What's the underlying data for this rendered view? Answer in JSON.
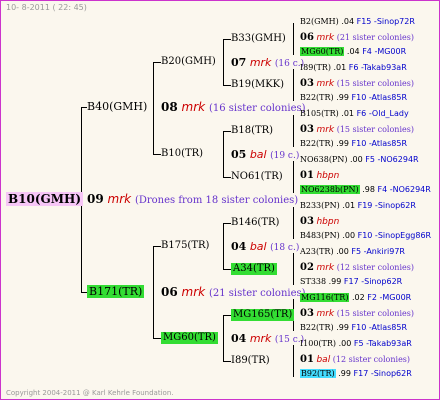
{
  "header": {
    "date": "10- 8-2011 ( 22: 45)"
  },
  "footer": {
    "copyright": "Copyright 2004-2011 @ Karl Kehrle Foundation."
  },
  "root": {
    "name": "B10(GMH)",
    "gen": "09",
    "mark": "mrk",
    "note": "(Drones from 18 sister colonies)"
  },
  "gen2": [
    {
      "name": "B40(GMH)",
      "gen": "08",
      "mark": "mrk",
      "note": "(16 sister colonies)"
    },
    {
      "name": "B171(TR)",
      "gen": "06",
      "mark": "mrk",
      "note": "(21 sister colonies)"
    }
  ],
  "gen3": [
    {
      "name": "B20(GMH)",
      "gen": "07",
      "mark": "mrk",
      "note": "(16 c.)"
    },
    {
      "name": "B10(TR)",
      "gen": "05",
      "mark": "bal",
      "note": "(19 c.)"
    },
    {
      "name": "B175(TR)",
      "gen": "04",
      "mark": "bal",
      "note": "(18 c.)"
    },
    {
      "name": "MG60(TR)",
      "gen": "04",
      "mark": "mrk",
      "note": "(15 c.)"
    }
  ],
  "gen4": [
    {
      "name": "B33(GMH)"
    },
    {
      "name": "B19(MKK)"
    },
    {
      "name": "B18(TR)"
    },
    {
      "name": "NO61(TR)"
    },
    {
      "name": "B146(TR)"
    },
    {
      "name": "A34(TR)"
    },
    {
      "name": "MG165(TR)"
    },
    {
      "name": "I89(TR)"
    }
  ],
  "gen5": [
    {
      "name": "B2(GMH)",
      "pct": ".04",
      "code": "F15 -Sinop72R"
    },
    {
      "gen": "06",
      "mark": "mrk",
      "note": "(21 sister colonies)"
    },
    {
      "name": "MG60(TR)",
      "pct": ".04",
      "code": "F4 -MG00R"
    },
    {
      "name": "I89(TR)",
      "pct": ".01",
      "code": "F6 -Takab93aR"
    },
    {
      "gen": "03",
      "mark": "mrk",
      "note": "(15 sister colonies)"
    },
    {
      "name": "B22(TR)",
      "pct": ".99",
      "code": "F10 -Atlas85R"
    },
    {
      "name": "B105(TR)",
      "pct": ".01",
      "code": "F6 -Old_Lady"
    },
    {
      "gen": "03",
      "mark": "mrk",
      "note": "(15 sister colonies)"
    },
    {
      "name": "B22(TR)",
      "pct": ".99",
      "code": "F10 -Atlas85R"
    },
    {
      "name": "NO638(PN)",
      "pct": ".00",
      "code": "F5 -NO6294R"
    },
    {
      "gen": "01",
      "mark": "hbpn",
      "note": ""
    },
    {
      "name": "NO6238b(PN)",
      "pct": ".98",
      "code": "F4 -NO6294R"
    },
    {
      "name": "B233(PN)",
      "pct": ".01",
      "code": "F19 -Sinop62R"
    },
    {
      "gen": "03",
      "mark": "hbpn",
      "note": ""
    },
    {
      "name": "B483(PN)",
      "pct": ".00",
      "code": "F10 -SinopEgg86R"
    },
    {
      "name": "A23(TR)",
      "pct": ".00",
      "code": "F5 -Ankiri97R"
    },
    {
      "gen": "02",
      "mark": "mrk",
      "note": "(12 sister colonies)"
    },
    {
      "name": "ST338",
      "pct": ".99",
      "code": "F17 -Sinop62R"
    },
    {
      "name": "MG116(TR)",
      "pct": ".02",
      "code": "F2 -MG00R"
    },
    {
      "gen": "03",
      "mark": "mrk",
      "note": "(15 sister colonies)"
    },
    {
      "name": "B22(TR)",
      "pct": ".99",
      "code": "F10 -Atlas85R"
    },
    {
      "name": "I100(TR)",
      "pct": ".00",
      "code": "F5 -Takab93aR"
    },
    {
      "gen": "01",
      "mark": "bal",
      "note": "(12 sister colonies)"
    },
    {
      "name": "B92(TR)",
      "pct": ".99",
      "code": "F17 -Sinop62R"
    }
  ],
  "colors": {
    "frame": "#cc33cc",
    "highlight_green": "#33dd33",
    "highlight_cyan": "#44ddff",
    "highlight_pink": "#f7c6f7",
    "mark_red": "#cc0000",
    "note_purple": "#6633cc",
    "code_blue": "#0000cc"
  }
}
